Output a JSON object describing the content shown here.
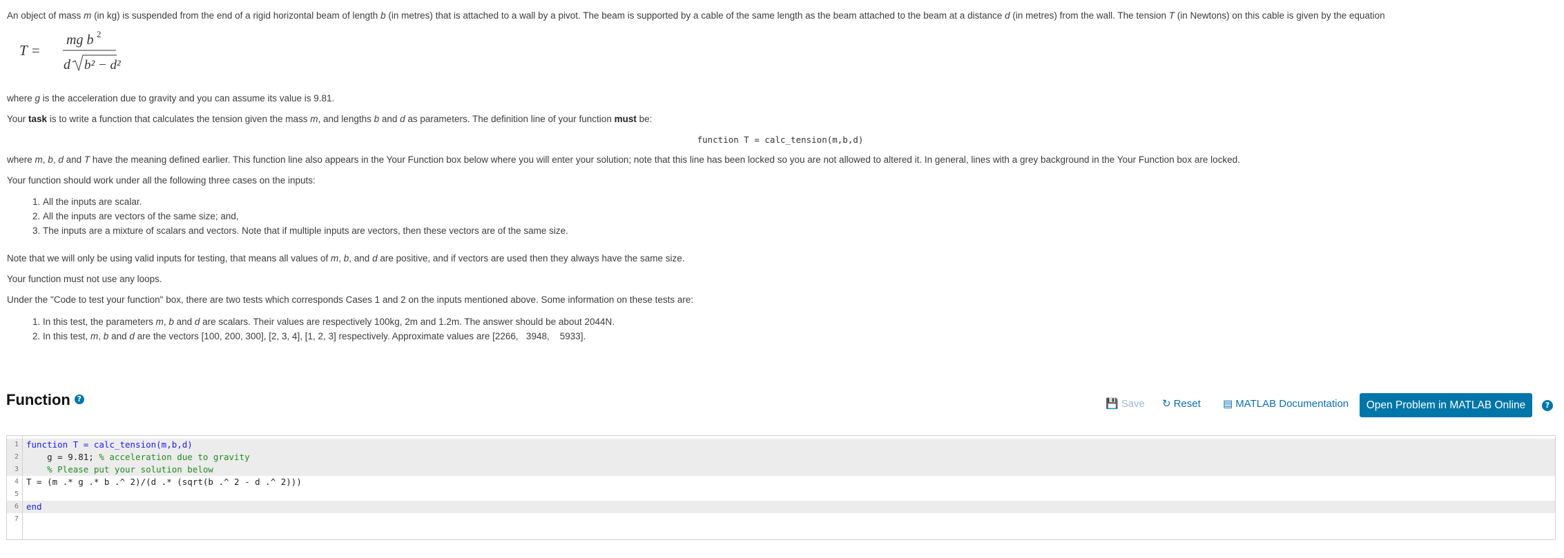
{
  "intro": {
    "p1": "An object of mass m (in kg) is suspended from the end of a rigid horizontal beam of length b (in metres) that is attached to a wall by a pivot. The beam is supported by a cable of the same length as the beam attached to the beam at a distance d (in metres) from the wall. The tension T (in Newtons) on this cable is given by the equation",
    "formula_lhs": "T =",
    "formula_num": "mg b",
    "formula_num_exp": "2",
    "formula_den_d": "d",
    "formula_den_expr": "b² − d²",
    "p_g": "where g is the acceleration due to gravity and you can assume its value is 9.81.",
    "p_task": "Your task is to write a function that calculates the tension given the mass m, and lengths b and d as parameters. The definition line of your function must be:",
    "def_line": "function T = calc_tension(m,b,d)",
    "p_meaning": "where m, b, d and T have the meaning defined earlier. This function line also appears in the Your Function box below where you will enter your solution; note that this line has been locked so you are not allowed to altered it. In general, lines with a grey background in the Your Function box are locked.",
    "p_cases": "Your function should work under all the following three cases on the inputs:",
    "cases": [
      "All the inputs are scalar.",
      "All the inputs are vectors of the same size; and,",
      "The inputs are a mixture of scalars and vectors. Note that if multiple inputs are vectors, then these vectors are of the same size."
    ],
    "p_valid": "Note that we will only be using valid inputs for testing, that means all values of m, b, and d are positive, and if vectors are used then they always have the same size.",
    "p_loops": "Your function must not use any loops.",
    "p_tests": "Under the \"Code to test your function\" box, there are two tests which corresponds Cases 1 and 2 on the inputs mentioned above. Some information on these tests are:",
    "tests": [
      "In this test, the parameters m, b and d are scalars. Their values are respectively 100kg, 2m and 1.2m. The answer should be about 2044N.",
      "In this test, m, b and d are the vectors [100, 200, 300], [2, 3, 4], [1, 2, 3] respectively. Approximate values are [2266,   3948,    5933]."
    ]
  },
  "function_panel": {
    "title": "Function",
    "save_label": "Save",
    "reset_label": "Reset",
    "doc_label": "MATLAB Documentation",
    "open_label": "Open Problem in MATLAB Online"
  },
  "editor": {
    "lines": [
      {
        "num": "1",
        "code": "function T = calc_tension(m,b,d)",
        "locked": true
      },
      {
        "num": "2",
        "code": "    g = 9.81; % acceleration due to gravity",
        "locked": true
      },
      {
        "num": "3",
        "code": "    % Please put your solution below",
        "locked": true
      },
      {
        "num": "4",
        "code": "T = (m .* g .* b .^ 2)/(d .* (sqrt(b .^ 2 - d .^ 2)))",
        "locked": false
      },
      {
        "num": "5",
        "code": "",
        "locked": false
      },
      {
        "num": "6",
        "code": "end",
        "locked": true
      },
      {
        "num": "7",
        "code": "",
        "locked": false
      }
    ]
  },
  "colors": {
    "accent": "#0076a8",
    "link": "#0a6fb4",
    "locked_bg": "#ececec"
  }
}
